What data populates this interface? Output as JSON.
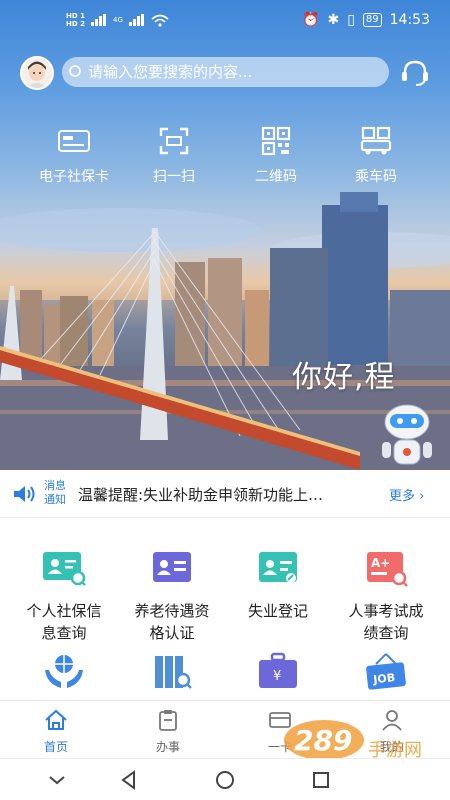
{
  "status_bar": {
    "sim1": "HD 1",
    "sim2": "HD 2",
    "network": "4G",
    "battery": "89",
    "time": "14:53"
  },
  "search": {
    "placeholder": "请输入您要搜索的内容..."
  },
  "quick_actions": [
    {
      "label": "电子社保卡",
      "icon": "social-card-icon"
    },
    {
      "label": "扫一扫",
      "icon": "scan-icon"
    },
    {
      "label": "二维码",
      "icon": "qr-code-icon"
    },
    {
      "label": "乘车码",
      "icon": "bus-code-icon"
    }
  ],
  "greeting": "你好,程",
  "notice": {
    "tag_line1": "消息",
    "tag_line2": "通知",
    "text": "温馨提醒:失业补助金申领新功能上…",
    "more": "更多"
  },
  "services": [
    {
      "label_line1": "个人社保信",
      "label_line2": "息查询",
      "icon": "profile-search-icon"
    },
    {
      "label_line1": "养老待遇资",
      "label_line2": "格认证",
      "icon": "id-card-icon"
    },
    {
      "label_line1": "失业登记",
      "label_line2": "",
      "icon": "unemployment-card-icon"
    },
    {
      "label_line1": "人事考试成",
      "label_line2": "绩查询",
      "icon": "exam-score-icon"
    }
  ],
  "services_row2_icons": [
    "globe-hands-icon",
    "archive-search-icon",
    "briefcase-yuan-icon",
    "job-sign-icon"
  ],
  "job_sign_text": "JOB",
  "tabs": [
    {
      "label": "首页",
      "active": true
    },
    {
      "label": "办事",
      "active": false
    },
    {
      "label": "一卡",
      "active": false
    },
    {
      "label": "我的",
      "active": false
    }
  ],
  "watermark": {
    "number": "289",
    "text": "手游网"
  },
  "colors": {
    "accent": "#2b7de0",
    "icon_teal": "#35c2b4",
    "icon_purple": "#6c68d9",
    "icon_red": "#f26b6b",
    "icon_blue": "#3f86e6"
  }
}
